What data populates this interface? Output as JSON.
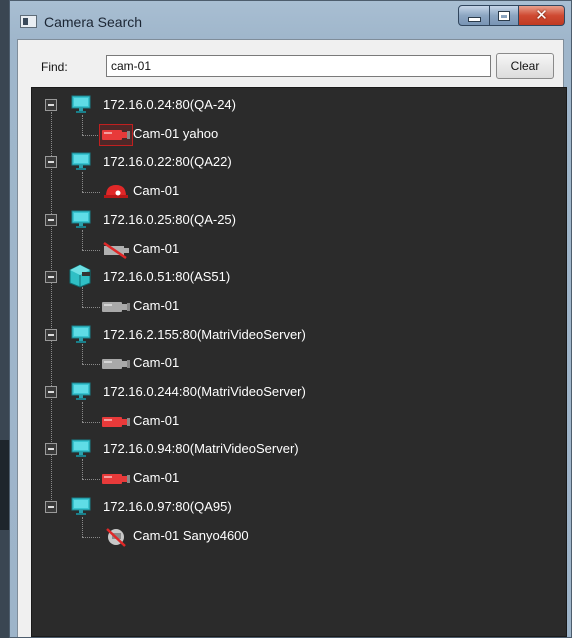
{
  "window": {
    "title": "Camera Search"
  },
  "search": {
    "label": "Find:",
    "value": "cam-01",
    "clear_label": "Clear"
  },
  "servers": [
    {
      "label": "172.16.0.24:80(QA-24)",
      "icon": "monitor-icon",
      "cameras": [
        {
          "label": "Cam-01 yahoo",
          "icon": "bullet-camera-icon",
          "status": "error",
          "color": "#e83a3a",
          "selected": true
        }
      ]
    },
    {
      "label": "172.16.0.22:80(QA22)",
      "icon": "monitor-icon",
      "cameras": [
        {
          "label": "Cam-01",
          "icon": "dome-camera-icon",
          "status": "error",
          "color": "#e02828"
        }
      ]
    },
    {
      "label": "172.16.0.25:80(QA-25)",
      "icon": "monitor-icon",
      "cameras": [
        {
          "label": "Cam-01",
          "icon": "camera-disabled-icon",
          "status": "disabled",
          "color": "#b0b0b0"
        }
      ]
    },
    {
      "label": "172.16.0.51:80(AS51)",
      "icon": "nvr-box-icon",
      "cameras": [
        {
          "label": "Cam-01",
          "icon": "bullet-camera-icon",
          "status": "offline",
          "color": "#a9a9a9"
        }
      ]
    },
    {
      "label": "172.16.2.155:80(MatriVideoServer)",
      "icon": "monitor-icon",
      "cameras": [
        {
          "label": "Cam-01",
          "icon": "bullet-camera-icon",
          "status": "offline",
          "color": "#a9a9a9"
        }
      ]
    },
    {
      "label": "172.16.0.244:80(MatriVideoServer)",
      "icon": "monitor-icon",
      "cameras": [
        {
          "label": "Cam-01",
          "icon": "bullet-camera-icon",
          "status": "error",
          "color": "#e83a3a"
        }
      ]
    },
    {
      "label": "172.16.0.94:80(MatriVideoServer)",
      "icon": "monitor-icon",
      "cameras": [
        {
          "label": "Cam-01",
          "icon": "bullet-camera-icon",
          "status": "error",
          "color": "#e83a3a"
        }
      ]
    },
    {
      "label": "172.16.0.97:80(QA95)",
      "icon": "monitor-icon",
      "cameras": [
        {
          "label": "Cam-01  Sanyo4600",
          "icon": "ptz-camera-disabled-icon",
          "status": "disabled",
          "color": "#c8c8c8"
        }
      ]
    }
  ],
  "colors": {
    "tree_background": "#2b2b2b",
    "monitor": "#38c4d0",
    "camera_error": "#e83a3a",
    "camera_offline": "#a9a9a9",
    "window_frame": "#a8bed2"
  }
}
